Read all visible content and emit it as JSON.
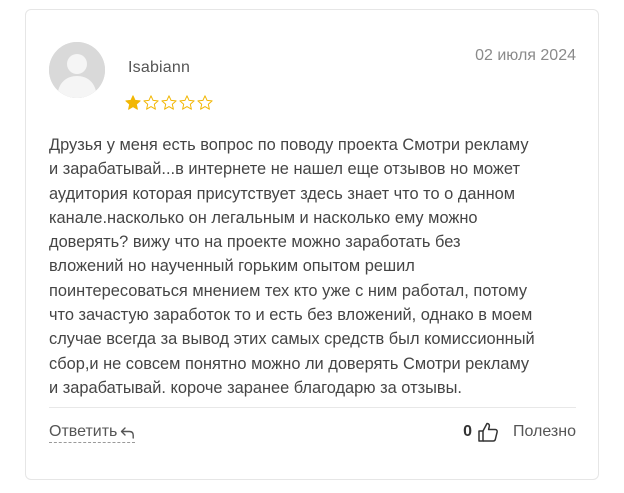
{
  "review": {
    "author": "Isabiann",
    "date": "02 июля 2024",
    "rating": 1,
    "max_rating": 5,
    "text": "Друзья у меня есть вопрос по поводу проекта Смотри рекламу\nи зарабатывай...в интернете не нашел еще отзывов но может\nаудитория которая присутствует здесь знает что то о данном\nканале.насколько он легальным и насколько ему можно\nдоверять? вижу что на проекте можно заработать без\nвложений но наученный горьким опытом решил\nпоинтересоваться мнением тех кто уже с ним работал, потому\nчто зачастую заработок то и есть без вложений, однако в моем\nслучае всегда за вывод этих самых средств был комиссионный\nсбор,и не совсем понятно можно ли доверять Смотри рекламу\nи зарабатывай. короче заранее благодарю за отзывы."
  },
  "actions": {
    "reply_label": "Ответить",
    "helpful_count": "0",
    "helpful_label": "Полезно"
  },
  "colors": {
    "star_filled": "#F2B705",
    "star_empty": "#F2B705",
    "avatar_bg": "#D9D9D9",
    "text": "#454545",
    "muted": "#8A8A8A"
  },
  "icons": {
    "avatar": "user-avatar-placeholder",
    "star": "star-icon",
    "reply": "reply-arrow-icon",
    "helpful": "thumbs-up-icon"
  }
}
